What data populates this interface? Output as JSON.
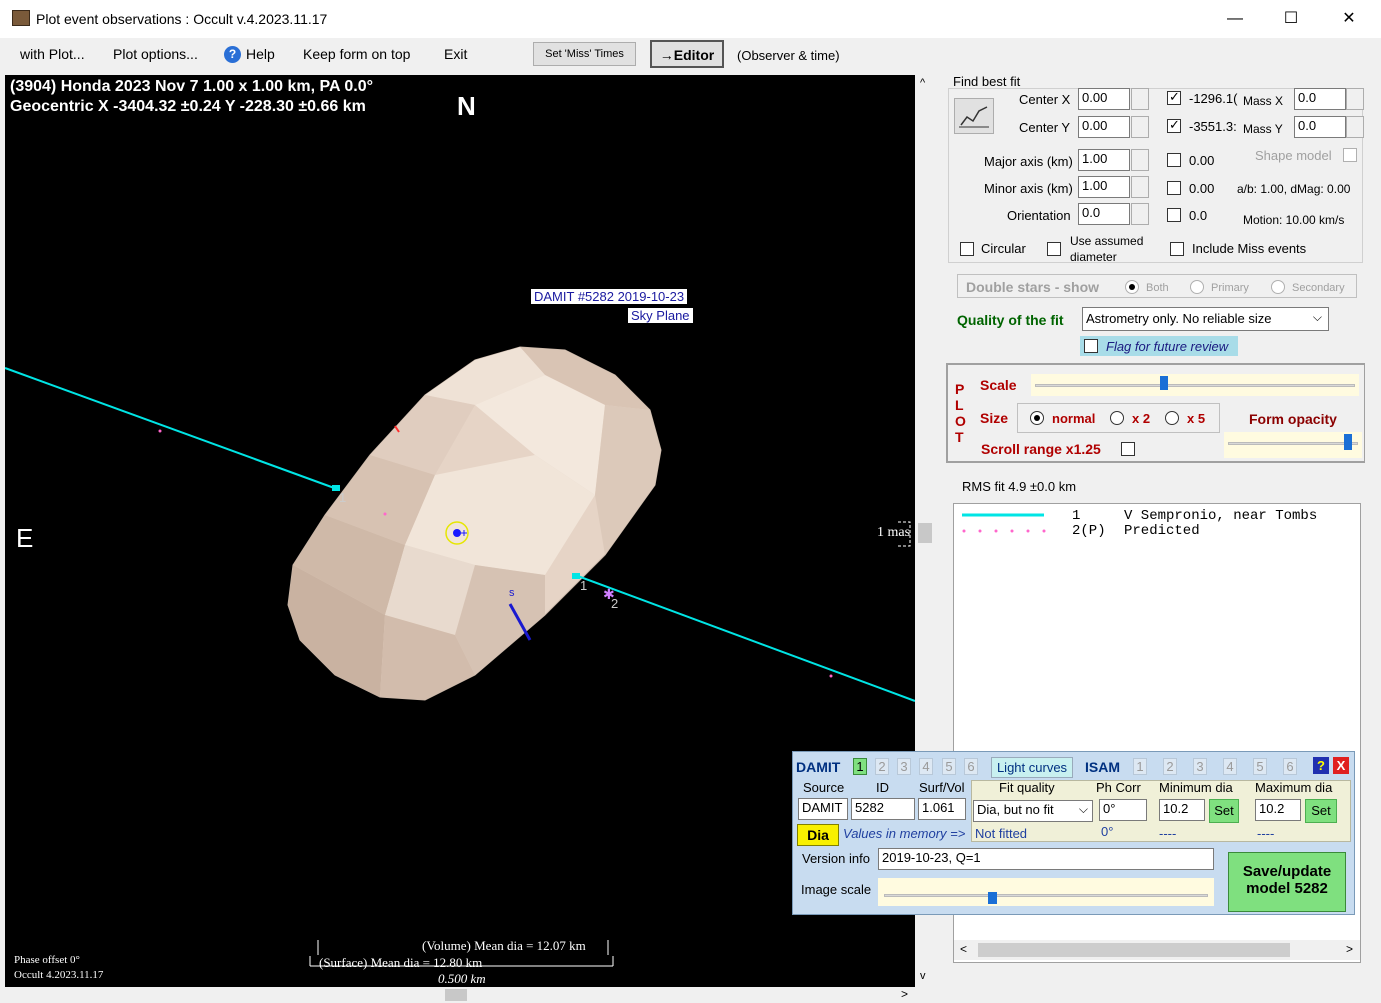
{
  "window": {
    "title": "Plot event observations : Occult v.4.2023.11.17",
    "minimize": "—",
    "maximize": "☐",
    "close": "✕"
  },
  "menu": {
    "with_plot": "with Plot...",
    "plot_options": "Plot options...",
    "help": "Help",
    "keep_on_top": "Keep form on top",
    "exit": "Exit",
    "set_miss_times": "Set 'Miss' Times",
    "editor": "→Editor",
    "observer_time": "(Observer & time)"
  },
  "plot": {
    "header_line1": "(3904) Honda  2023 Nov 7   1.00 x 1.00 km, PA 0.0°",
    "header_line2": "Geocentric  X  -3404.32 ±0.24  Y -228.30 ±0.66 km",
    "north": "N",
    "east": "E",
    "damit_label": "DAMIT #5282 2019-10-23",
    "sky_plane": "Sky Plane",
    "chord1_label_a": "1",
    "chord1_label_b": "1",
    "chord2_label": "2",
    "s_label": "s",
    "scale_mas": "1 mas",
    "volume_dia": "(Volume) Mean dia = 12.07 km",
    "surface_dia": "(Surface) Mean dia = 12.80 km",
    "scale_km": "0.500 km",
    "phase_offset": "Phase offset 0°",
    "occult_version": "Occult 4.2023.11.17"
  },
  "fit": {
    "find_best_fit": "Find best fit",
    "center_x_label": "Center X",
    "center_x": "0.00",
    "center_y_label": "Center Y",
    "center_y": "0.00",
    "center_x_val": "-1296.1(",
    "center_y_val": "-3551.3:",
    "mass_x_label": "Mass X",
    "mass_x": "0.0",
    "mass_y_label": "Mass Y",
    "mass_y": "0.0",
    "major_label": "Major axis (km)",
    "major": "1.00",
    "minor_label": "Minor axis (km)",
    "minor": "1.00",
    "orient_label": "Orientation",
    "orient": "0.0",
    "major_chk": "0.00",
    "minor_chk": "0.00",
    "orient_chk": "0.0",
    "shape_model": "Shape model",
    "ab_dmag": "a/b: 1.00, dMag: 0.00",
    "motion": "Motion: 10.00 km/s",
    "circular": "Circular",
    "use_assumed": "Use assumed",
    "diameter": "diameter",
    "include_miss": "Include Miss events",
    "double_stars": "Double stars - show",
    "both": "Both",
    "primary": "Primary",
    "secondary": "Secondary",
    "quality_label": "Quality of the fit",
    "quality_value": "Astrometry only. No reliable size",
    "flag_review": "Flag for future review"
  },
  "plotctl": {
    "plot_letters": [
      "P",
      "L",
      "O",
      "T"
    ],
    "scale": "Scale",
    "scale_level": 0.4,
    "size": "Size",
    "normal": "normal",
    "x2": "x 2",
    "x5": "x 5",
    "form_opacity": "Form opacity",
    "opacity_level": 0.95,
    "scroll_range": "Scroll range x1.25"
  },
  "rms": "RMS fit 4.9 ±0.0 km",
  "legend": {
    "row1_num": "1",
    "row1_text": "V Sempronio, near Tombs",
    "row2_num": "2(P)",
    "row2_text": "Predicted",
    "colors": {
      "observed": "#00e5e5",
      "predicted": "#ff66cc"
    }
  },
  "damit": {
    "damit": "DAMIT",
    "tabs": [
      "1",
      "2",
      "3",
      "4",
      "5",
      "6"
    ],
    "light_curves": "Light curves",
    "isam": "ISAM",
    "isam_tabs": [
      "1",
      "2",
      "3",
      "4",
      "5",
      "6"
    ],
    "help": "?",
    "close": "X",
    "col_source": "Source",
    "col_id": "ID",
    "col_surf": "Surf/Vol",
    "col_fit": "Fit quality",
    "col_ph": "Ph Corr",
    "col_min": "Minimum dia",
    "col_max": "Maximum dia",
    "source": "DAMIT",
    "id": "5282",
    "surf": "1.061",
    "fit_quality": "Dia, but no fit",
    "ph_corr": "0°",
    "min_dia": "10.2",
    "max_dia": "10.2",
    "set": "Set",
    "dia": "Dia",
    "values_in_memory": "Values in memory =>",
    "not_fitted": "Not fitted",
    "mem_ph": "0°",
    "mem_min": "----",
    "mem_max": "----",
    "version_info_label": "Version info",
    "version_info": "2019-10-23, Q=1",
    "image_scale": "Image scale",
    "image_scale_level": 0.33,
    "save_update": "Save/update",
    "model": "model 5282"
  }
}
